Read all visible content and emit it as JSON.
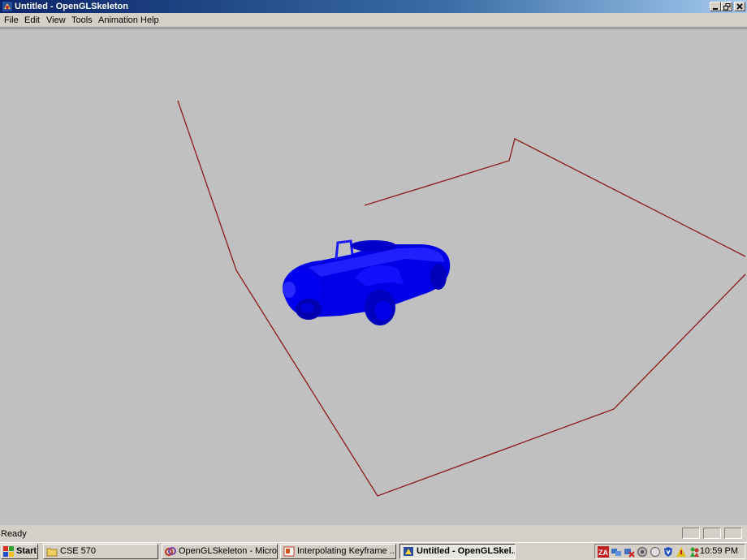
{
  "window": {
    "title": "Untitled - OpenGLSkeleton"
  },
  "menu": {
    "items": [
      "File",
      "Edit",
      "View",
      "Tools",
      "Animation",
      "Help"
    ]
  },
  "viewport": {
    "background": "#c0c0c0",
    "path_color": "#8b1a1a",
    "car_color": "#0000ff"
  },
  "status": {
    "text": "Ready"
  },
  "taskbar": {
    "start_label": "Start",
    "tasks": [
      {
        "label": "CSE 570",
        "icon": "folder-icon",
        "active": false
      },
      {
        "label": "OpenGLSkeleton - Micros...",
        "icon": "visual-studio-icon",
        "active": false
      },
      {
        "label": "Interpolating Keyframe ...",
        "icon": "powerpoint-icon",
        "active": false
      },
      {
        "label": "Untitled - OpenGLSkel...",
        "icon": "opengl-app-icon",
        "active": true
      }
    ],
    "clock": "10:59 PM"
  }
}
